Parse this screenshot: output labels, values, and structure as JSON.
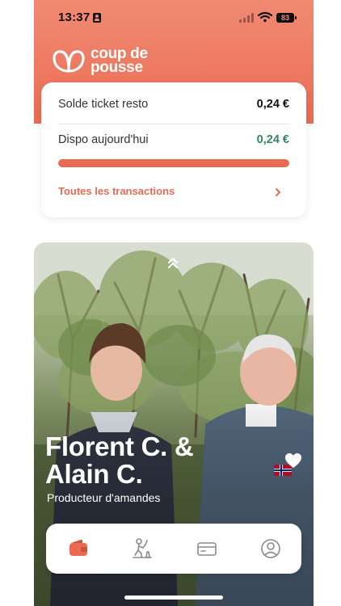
{
  "status_bar": {
    "time": "13:37",
    "battery": "83"
  },
  "brand": {
    "line1": "coup de",
    "line2": "pousse",
    "color": "#ea6a52"
  },
  "balance_card": {
    "balance_label": "Solde ticket resto",
    "balance_value": "0,24 €",
    "available_label": "Dispo aujourd'hui",
    "available_value": "0,24 €",
    "available_color": "#2f8a5e",
    "progress_fraction": 1.0,
    "transactions_link": "Toutes les transactions"
  },
  "feature": {
    "producer_name": "Florent C. & Alain C.",
    "producer_role": "Producteur d'amandes",
    "favorite_icon": "heart-icon",
    "expand_icon": "chevrons-up-icon"
  },
  "tab_bar": {
    "tabs": [
      {
        "icon": "wallet-icon",
        "active": true
      },
      {
        "icon": "producer-icon",
        "active": false
      },
      {
        "icon": "card-icon",
        "active": false
      },
      {
        "icon": "profile-icon",
        "active": false
      }
    ]
  }
}
